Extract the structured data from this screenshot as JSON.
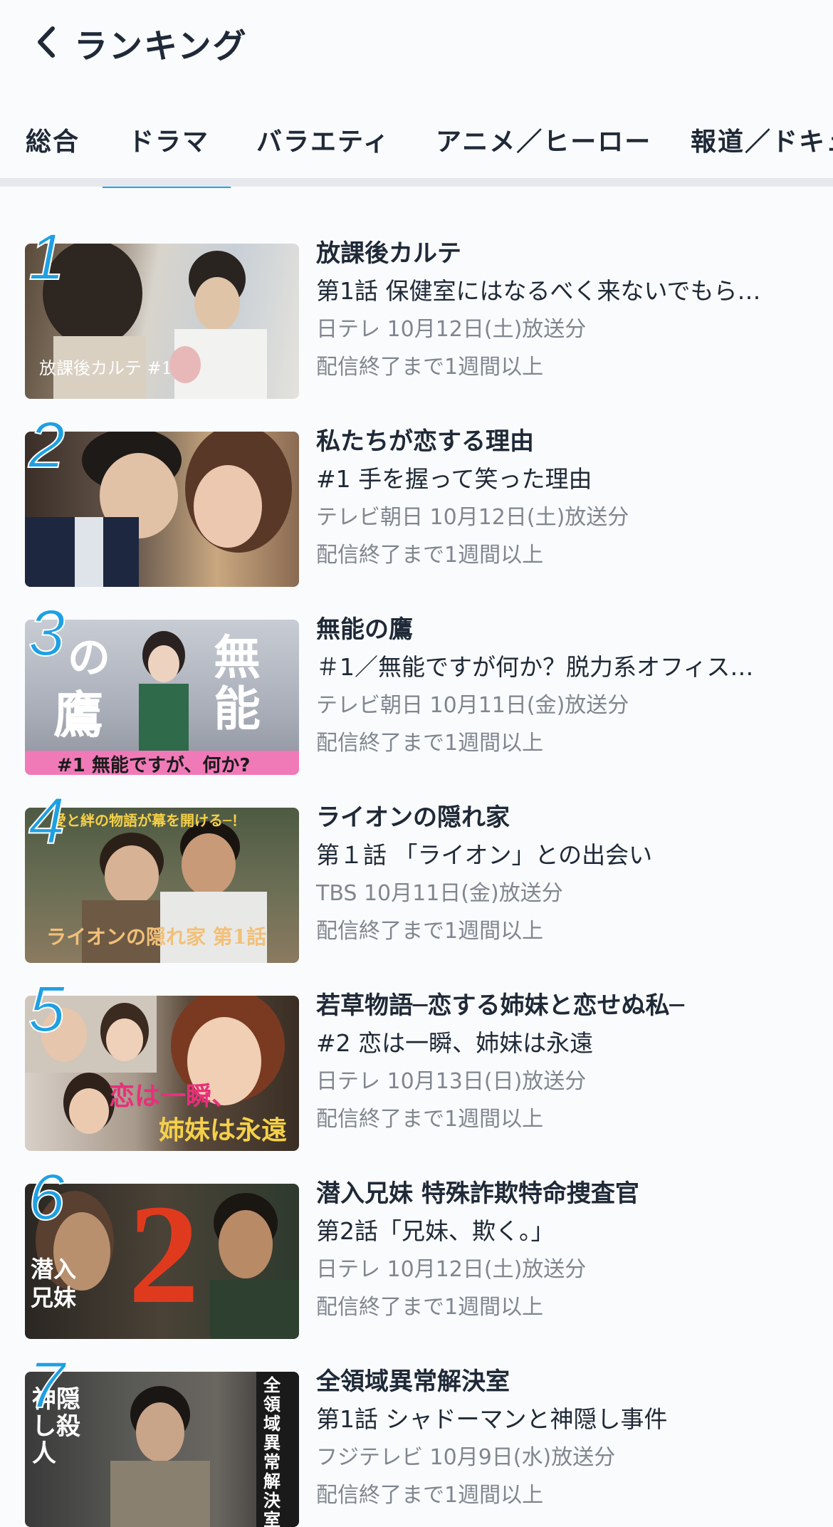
{
  "header": {
    "title": "ランキング",
    "back_icon": "chevron-left-icon"
  },
  "tabs": [
    {
      "label": "総合",
      "active": false
    },
    {
      "label": "ドラマ",
      "active": true
    },
    {
      "label": "バラエティ",
      "active": false
    },
    {
      "label": "アニメ／ヒーロー",
      "active": false
    },
    {
      "label": "報道／ドキュ",
      "active": false
    }
  ],
  "accent_color": "#1aa8e0",
  "rankings": [
    {
      "rank": "1",
      "title": "放課後カルテ",
      "episode": "第1話 保健室にはなるべく来ないでもら…",
      "air": "日テレ 10月12日(土)放送分",
      "availability": "配信終了まで1週間以上",
      "thumb_text": "放課後カルテ #1"
    },
    {
      "rank": "2",
      "title": "私たちが恋する理由",
      "episode": "#1 手を握って笑った理由",
      "air": "テレビ朝日 10月12日(土)放送分",
      "availability": "配信終了まで1週間以上"
    },
    {
      "rank": "3",
      "title": "無能の鷹",
      "episode": "＃1／無能ですが何か？脱力系オフィス…",
      "air": "テレビ朝日 10月11日(金)放送分",
      "availability": "配信終了まで1週間以上",
      "thumb_text": "#1 無能ですが、何か?",
      "thumb_big": [
        "無",
        "能",
        "鷹",
        "の"
      ]
    },
    {
      "rank": "4",
      "title": "ライオンの隠れ家",
      "episode": "第１話 「ライオン」との出会い",
      "air": "TBS 10月11日(金)放送分",
      "availability": "配信終了まで1週間以上",
      "thumb_text": "ライオンの隠れ家 第1話",
      "thumb_top": "愛と絆の物語が幕を開ける─！"
    },
    {
      "rank": "5",
      "title": "若草物語─恋する姉妹と恋せぬ私─",
      "episode": "#2 恋は一瞬、姉妹は永遠",
      "air": "日テレ 10月13日(日)放送分",
      "availability": "配信終了まで1週間以上",
      "thumb_lines": [
        "恋は一瞬、",
        "姉妹は永遠"
      ]
    },
    {
      "rank": "6",
      "title": "潜入兄妹 特殊詐欺特命捜査官",
      "episode": "第2話「兄妹、欺く。」",
      "air": "日テレ 10月12日(土)放送分",
      "availability": "配信終了まで1週間以上",
      "thumb_text": "潜入兄妹",
      "thumb_big": "2"
    },
    {
      "rank": "7",
      "title": "全領域異常解決室",
      "episode": "第1話 シャドーマンと神隠し事件",
      "air": "フジテレビ 10月9日(水)放送分",
      "availability": "配信終了まで1週間以上",
      "thumb_text": "神隠し殺人",
      "thumb_side": "全領域異常解決室"
    }
  ]
}
